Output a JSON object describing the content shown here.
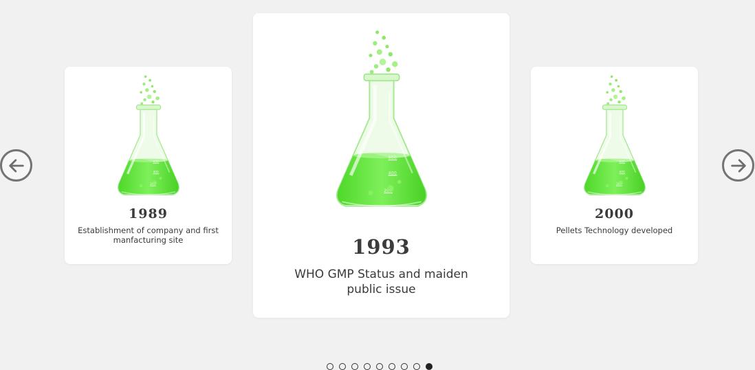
{
  "carousel": {
    "cards": [
      {
        "year": "1989",
        "description": "Establishment of company and first manfacturing site"
      },
      {
        "year": "1993",
        "description": "WHO GMP Status and maiden public issue"
      },
      {
        "year": "2000",
        "description": "Pellets Technology developed"
      }
    ],
    "flask_icon": "erlenmeyer-flask-icon",
    "flask_scale_labels": [
      "600",
      "400",
      "200"
    ],
    "active_slide_index": 9,
    "slide_count": 9
  },
  "navigation": {
    "prev_icon": "arrow-left-circle-icon",
    "next_icon": "arrow-right-circle-icon"
  },
  "colors": {
    "background": "#f1f1f1",
    "card": "#ffffff",
    "liquid": "#5ee638",
    "text": "#3b3b3b"
  }
}
